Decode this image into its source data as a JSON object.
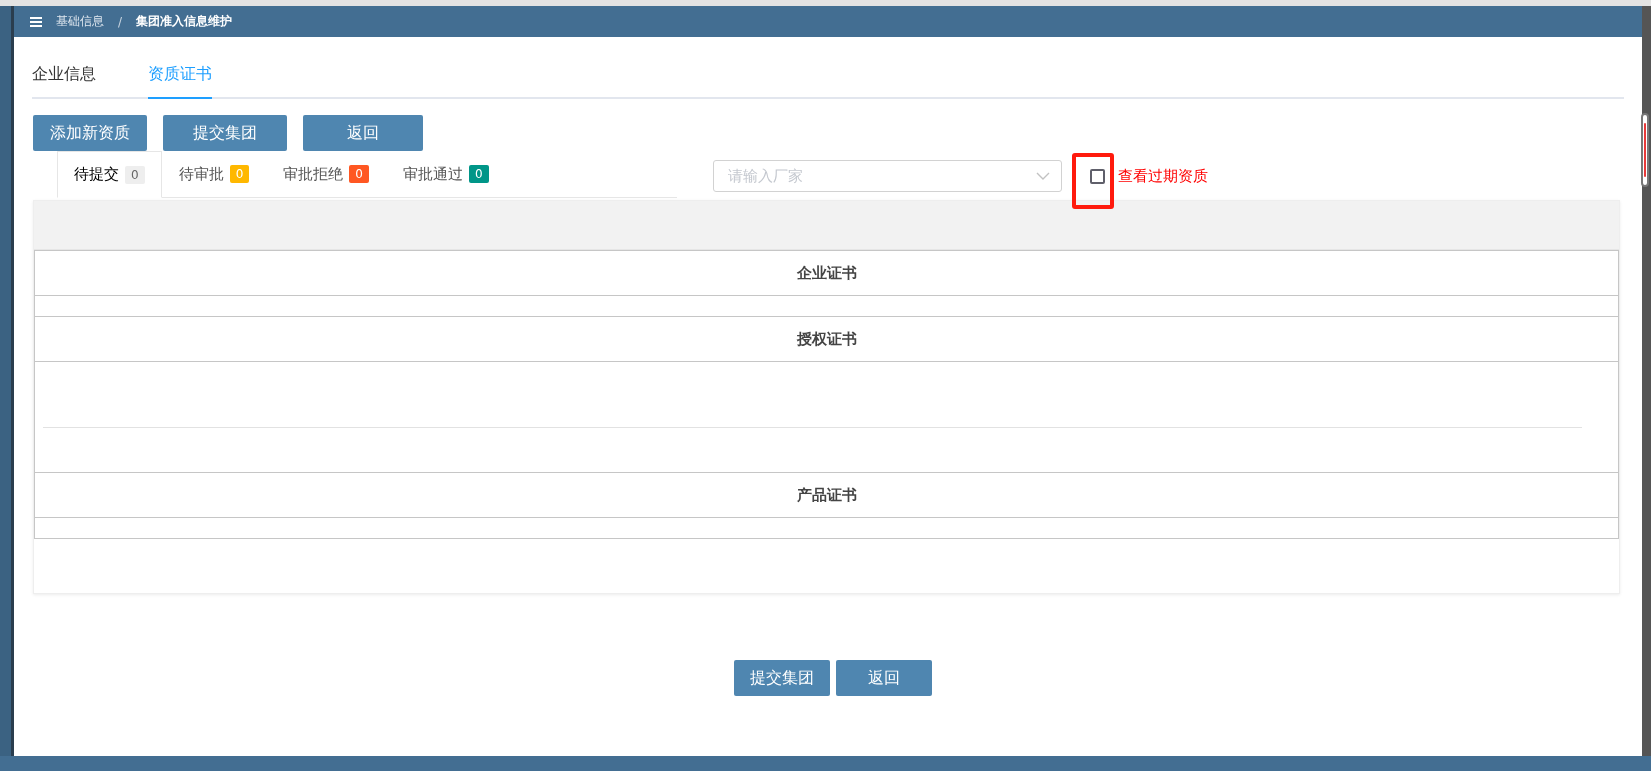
{
  "breadcrumb": {
    "items": [
      "基础信息",
      "集团准入信息维护"
    ],
    "separator": "/"
  },
  "tabs": [
    {
      "label": "企业信息",
      "selected": false
    },
    {
      "label": "资质证书",
      "selected": true
    }
  ],
  "toolbar_buttons": [
    "添加新资质",
    "提交集团",
    "返回"
  ],
  "status_tabs": [
    {
      "label": "待提交",
      "count": "0",
      "color": "#eeeeee",
      "selected": true
    },
    {
      "label": "待审批",
      "count": "0",
      "color": "#ffb800",
      "selected": false
    },
    {
      "label": "审批拒绝",
      "count": "0",
      "color": "#ff5722",
      "selected": false
    },
    {
      "label": "审批通过",
      "count": "0",
      "color": "#009688",
      "selected": false
    }
  ],
  "manufacturer_select": {
    "placeholder": "请输入厂家"
  },
  "expired_checkbox": {
    "label": "查看过期资质",
    "checked": false,
    "highlighted": true
  },
  "sections": [
    {
      "title": "企业证书",
      "kind": "compact"
    },
    {
      "title": "授权证书",
      "kind": "expanded"
    },
    {
      "title": "产品证书",
      "kind": "compact"
    }
  ],
  "footer_buttons": [
    "提交集团",
    "返回"
  ]
}
